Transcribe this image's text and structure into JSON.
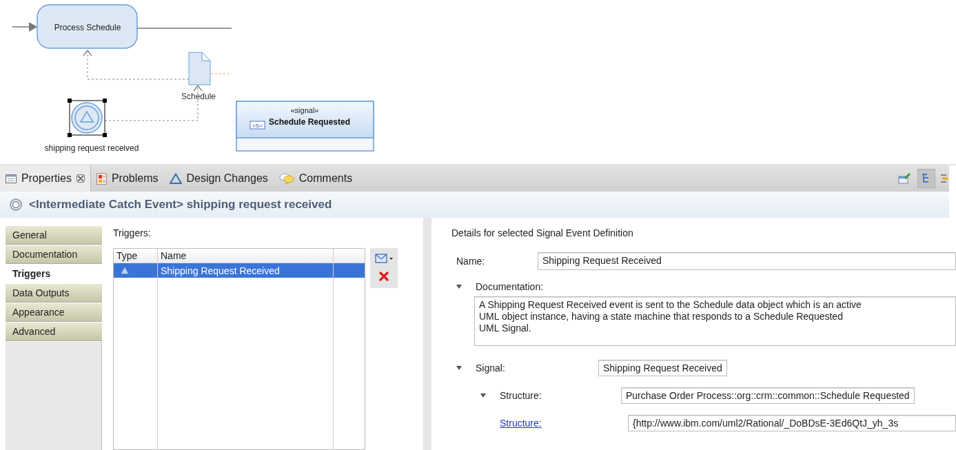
{
  "diagram": {
    "task": {
      "label": "Process Schedule"
    },
    "data_object": {
      "label": "Schedule"
    },
    "event": {
      "label": "shipping request received",
      "selected": true
    },
    "signal_class": {
      "stereotype": "«signal»",
      "icon_text": "<S>",
      "name": "Schedule Requested"
    }
  },
  "tabs": [
    {
      "label": "Properties",
      "selected": true,
      "kind": "properties"
    },
    {
      "label": "Problems",
      "selected": false,
      "kind": "problems"
    },
    {
      "label": "Design Changes",
      "selected": false,
      "kind": "changes"
    },
    {
      "label": "Comments",
      "selected": false,
      "kind": "comments"
    }
  ],
  "title": "<Intermediate Catch Event> shipping request received",
  "sidebar": [
    {
      "label": "General",
      "selected": false
    },
    {
      "label": "Documentation",
      "selected": false
    },
    {
      "label": "Triggers",
      "selected": true
    },
    {
      "label": "Data Outputs",
      "selected": false
    },
    {
      "label": "Appearance",
      "selected": false
    },
    {
      "label": "Advanced",
      "selected": false
    }
  ],
  "triggers": {
    "label": "Triggers:",
    "columns": [
      "Type",
      "Name"
    ],
    "rows": [
      {
        "name": "Shipping Request Received",
        "selected": true
      }
    ]
  },
  "details": {
    "heading": "Details for selected Signal Event Definition",
    "name": {
      "label": "Name:",
      "value": "Shipping Request Received"
    },
    "documentation": {
      "label": "Documentation:",
      "expanded": true,
      "value": "A Shipping Request Received event is sent to the Schedule data object which is an active\nUML object instance, having a state machine that responds to a Schedule Requested\nUML Signal."
    },
    "signal": {
      "label": "Signal:",
      "expanded": true,
      "value": "Shipping Request Received"
    },
    "structure": {
      "label": "Structure:",
      "expanded": true,
      "value": "Purchase Order Process::org::crm::common::Schedule Requested"
    },
    "structure_link": {
      "label": "Structure:",
      "value": "{http://www.ibm.com/uml2/Rational/_DoBDsE-3Ed6QtJ_yh_3s"
    }
  }
}
